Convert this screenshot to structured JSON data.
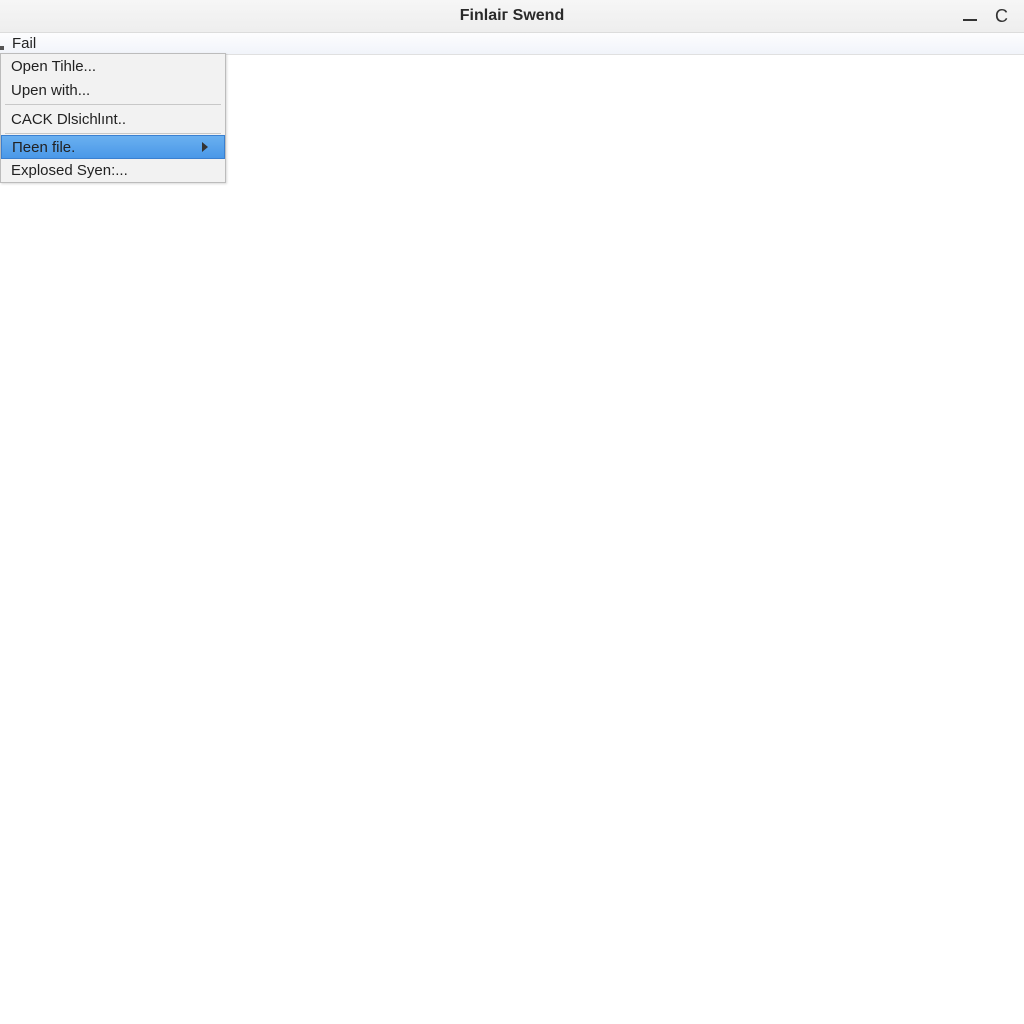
{
  "titlebar": {
    "title": "Finlaiг Swend"
  },
  "menubar": {
    "items": [
      {
        "label": "Fail"
      }
    ]
  },
  "dropdown": {
    "items": [
      {
        "label": "Open Tihle...",
        "highlighted": false,
        "submenu": false
      },
      {
        "label": "Upen with...",
        "highlighted": false,
        "submenu": false
      },
      {
        "sep": true
      },
      {
        "label": "CACK Dlsichlınt..",
        "highlighted": false,
        "submenu": false
      },
      {
        "sep": true
      },
      {
        "label": "Пeen file.",
        "highlighted": true,
        "submenu": true
      },
      {
        "label": "Explosed Syen:...",
        "highlighted": false,
        "submenu": false
      }
    ]
  }
}
